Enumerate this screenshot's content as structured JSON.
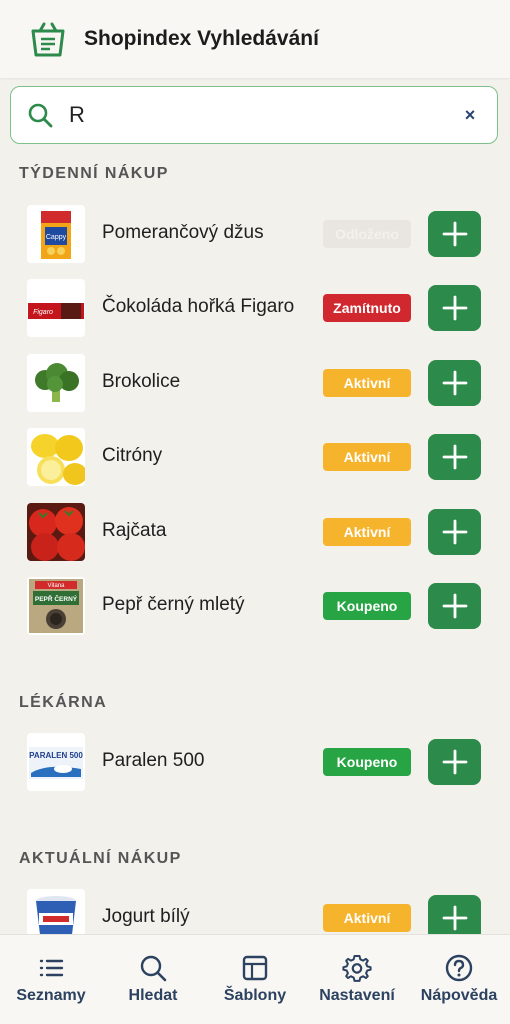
{
  "header": {
    "title": "Shopindex Vyhledávání",
    "logo_icon": "shopping-bag-icon"
  },
  "search": {
    "value": "R",
    "search_icon": "search-icon",
    "clear_icon": "close-icon",
    "clear_label": "×"
  },
  "colors": {
    "accent": "#2c8a4a",
    "odlozeno": "#e9e5e0",
    "zamitnuto": "#d0282e",
    "aktivni": "#f6b42d",
    "koupeno": "#27a444",
    "nav_text": "#2c4260"
  },
  "sections": [
    {
      "title": "TÝDENNÍ NÁKUP",
      "items": [
        {
          "name": "Pomerančový džus",
          "status": "Odloženo"
        },
        {
          "name": "Čokoláda hořká Figaro",
          "status": "Zamítnuto"
        },
        {
          "name": "Brokolice",
          "status": "Aktivní"
        },
        {
          "name": "Citróny",
          "status": "Aktivní"
        },
        {
          "name": "Rajčata",
          "status": "Aktivní"
        },
        {
          "name": "Pepř černý mletý",
          "status": "Koupeno"
        }
      ]
    },
    {
      "title": "LÉKÁRNA",
      "items": [
        {
          "name": "Paralen 500",
          "status": "Koupeno"
        }
      ]
    },
    {
      "title": "AKTUÁLNÍ NÁKUP",
      "items": [
        {
          "name": "Jogurt bílý",
          "status": "Aktivní"
        }
      ]
    }
  ],
  "product_image_text": {
    "juice": "Cappy",
    "chocolate": "Figaro",
    "pepper": "Vitana",
    "pepper_name": "PEPŘ ČERNÝ",
    "paralen": "PARALEN 500"
  },
  "nav": [
    {
      "label": "Seznamy",
      "icon": "list-icon"
    },
    {
      "label": "Hledat",
      "icon": "search-icon"
    },
    {
      "label": "Šablony",
      "icon": "template-icon"
    },
    {
      "label": "Nastavení",
      "icon": "gear-icon"
    },
    {
      "label": "Nápověda",
      "icon": "help-icon"
    }
  ]
}
